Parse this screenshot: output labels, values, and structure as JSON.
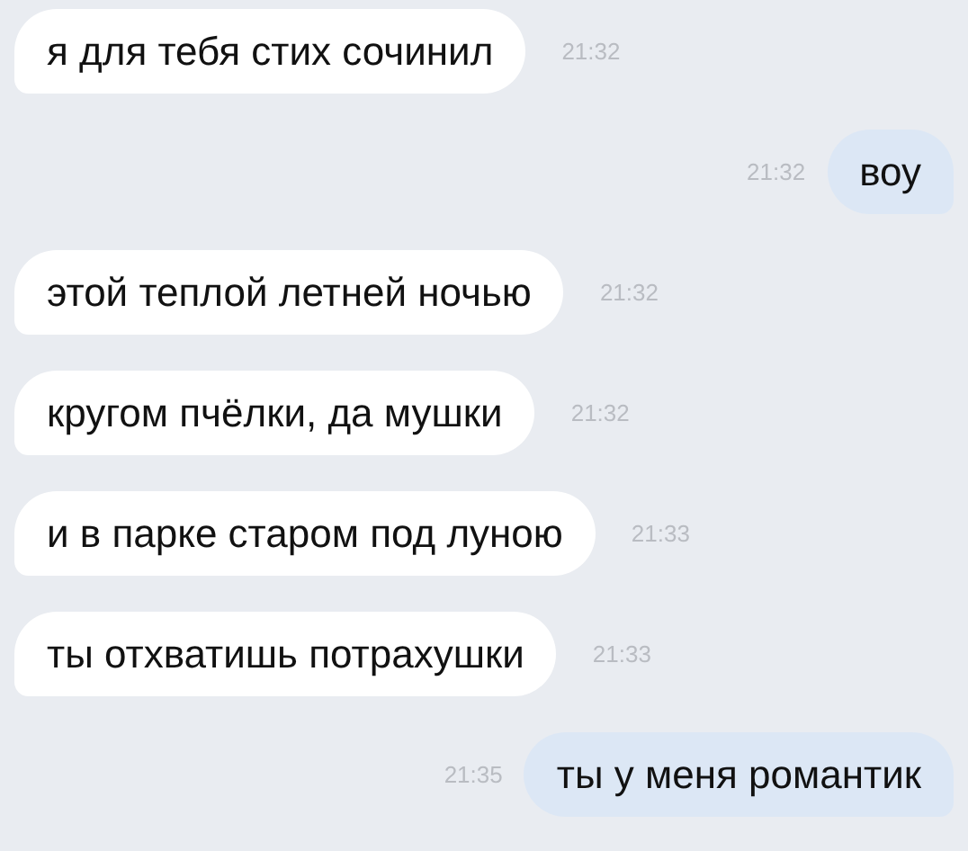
{
  "messages": [
    {
      "kind": "incoming",
      "text": "я для тебя стих сочинил",
      "time": "21:32"
    },
    {
      "kind": "outgoing",
      "text": "воу",
      "time": "21:32"
    },
    {
      "kind": "incoming",
      "text": "этой теплой летней ночью",
      "time": "21:32"
    },
    {
      "kind": "incoming",
      "text": "кругом пчёлки, да мушки",
      "time": "21:32"
    },
    {
      "kind": "incoming",
      "text": "и в парке старом под луною",
      "time": "21:33"
    },
    {
      "kind": "incoming",
      "text": "ты отхватишь потрахушки",
      "time": "21:33"
    },
    {
      "kind": "outgoing",
      "text": "ты у меня романтик",
      "time": "21:35"
    }
  ]
}
